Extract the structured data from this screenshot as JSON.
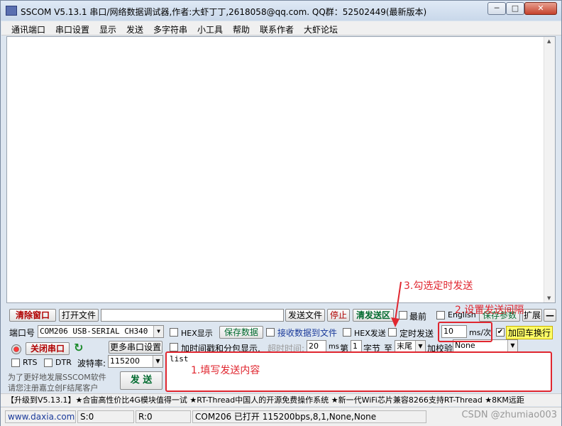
{
  "window": {
    "title": "SSCOM V5.13.1 串口/网络数据调试器,作者:大虾丁丁,2618058@qq.com. QQ群：52502449(最新版本)",
    "controls": {
      "minimize": "─",
      "maximize": "□",
      "close": "✕"
    }
  },
  "menu": [
    "通讯端口",
    "串口设置",
    "显示",
    "发送",
    "多字符串",
    "小工具",
    "帮助",
    "联系作者",
    "大虾论坛"
  ],
  "toolbar": {
    "clear_button": "清除窗口",
    "open_file_button": "打开文件",
    "send_file_button": "发送文件",
    "stop_button": "停止",
    "clear_send_button": "清发送区",
    "topmost_label": "最前",
    "english_label": "English",
    "save_params_button": "保存参数",
    "expand_button": "扩展",
    "collapse_button": "—"
  },
  "port": {
    "port_label": "端口号",
    "port_value": "COM206 USB-SERIAL CH340",
    "hex_display_label": "HEX显示",
    "save_data_button": "保存数据",
    "recv_to_file_label": "接收数据到文件",
    "hex_send_label": "HEX发送",
    "timed_send_label": "定时发送",
    "interval_value": "10",
    "interval_unit": "ms/次",
    "add_crlf_label": "加回车换行",
    "close_port_button": "关闭串口",
    "more_settings_button": "更多串口设置",
    "timestamp_label": "加时间戳和分包显示,",
    "timeout_label": "超时时间:",
    "timeout_value": "20",
    "timeout_unit": "ms",
    "nth_label": "第",
    "nth_value": "1",
    "byte_label": "字节",
    "to_label": "至",
    "end_value": "末尾",
    "checksum_label": "加校验",
    "checksum_value": "None",
    "rts_label": "RTS",
    "dtr_label": "DTR",
    "baud_label": "波特率:",
    "baud_value": "115200",
    "promo_line1": "为了更好地发展SSCOM软件",
    "promo_line2": "请您注册嘉立创F结尾客户",
    "send_button": "发 送",
    "send_content": "list"
  },
  "ticker": "【升级到V5.13.1】★合宙高性价比4G模块值得一试 ★RT-Thread中国人的开源免费操作系统 ★新一代WiFi芯片兼容8266支持RT-Thread ★8KM远距",
  "status_bar": {
    "website": "www.daxia.com",
    "sent": "S:0",
    "received": "R:0",
    "port_status": "COM206 已打开  115200bps,8,1,None,None"
  },
  "annotations": {
    "step1": "1.填写发送内容",
    "step2": "2.设置发送间隔",
    "step3": "3.勾选定时发送",
    "color": "#e0262f"
  },
  "watermark": "CSDN @zhumiao003"
}
